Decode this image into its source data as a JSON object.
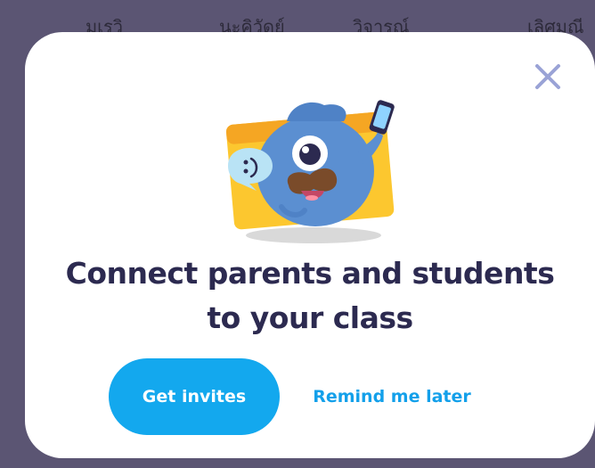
{
  "background": {
    "columns": [
      "มเรวิ",
      "นะคิวัดย์",
      "วิจารณ์",
      "เลิศมณี"
    ]
  },
  "modal": {
    "title_line1": "Connect parents and students",
    "title_line2": "to your class",
    "primary_button": "Get invites",
    "secondary_button": "Remind me later",
    "close_icon": "close-x-icon",
    "illustration": "monster-with-phone-illustration"
  },
  "colors": {
    "primary": "#13a8ee",
    "title_text": "#2c2a50",
    "overlay": "#5b5573",
    "close_icon": "#9aa3d6"
  }
}
